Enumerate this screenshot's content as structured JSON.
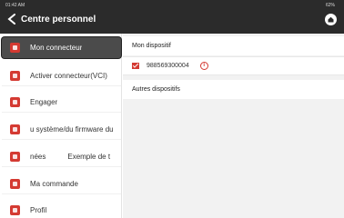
{
  "status": {
    "time": "01:42 AM",
    "battery": "62%"
  },
  "header": {
    "title": "Centre personnel"
  },
  "sidebar": {
    "items": [
      {
        "label": "Mon connecteur",
        "active": true,
        "icon": "lock-icon"
      },
      {
        "label": "Activer connecteur(VCI)",
        "active": false,
        "icon": "activate-icon"
      },
      {
        "label": "Engager",
        "active": false,
        "icon": "shield-icon"
      },
      {
        "label": "u système/du firmware du",
        "active": false,
        "icon": "tools-icon"
      },
      {
        "label": "nées",
        "label2": "Exemple de t",
        "active": false,
        "icon": "mail-icon"
      },
      {
        "label": "Ma commande",
        "active": false,
        "icon": "order-icon"
      },
      {
        "label": "Profil",
        "active": false,
        "icon": "profile-icon"
      }
    ]
  },
  "main": {
    "my_devices_title": "Mon dispositif",
    "device_serial": "988569300004",
    "other_devices_title": "Autres dispositifs"
  },
  "colors": {
    "accent": "#d43a32",
    "topbar": "#2b2b2b",
    "active_item": "#4b4b4b"
  }
}
